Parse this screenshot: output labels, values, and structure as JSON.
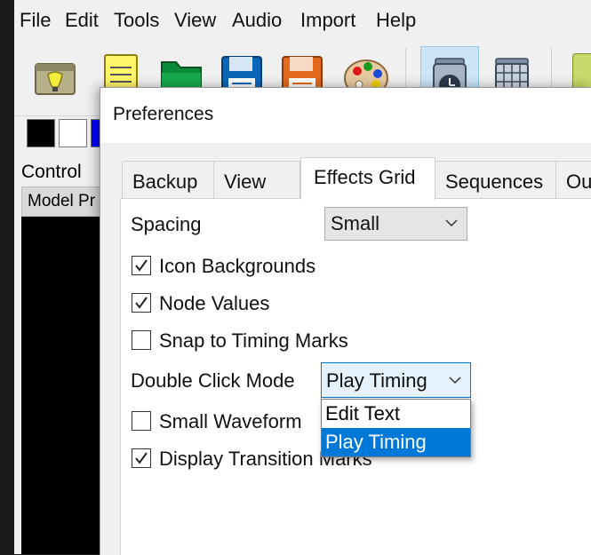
{
  "menubar": {
    "items": [
      "File",
      "Edit",
      "Tools",
      "View",
      "Audio",
      "Import",
      "Help"
    ]
  },
  "toolbar": {
    "buttons": [
      {
        "icon": "light-bulb-icon"
      },
      {
        "icon": "notepad-icon"
      },
      {
        "icon": "folder-open-icon"
      },
      {
        "icon": "save-icon"
      },
      {
        "icon": "save-as-icon"
      },
      {
        "icon": "color-palette-icon"
      },
      {
        "icon": "timer-clock-icon"
      },
      {
        "icon": "calendar-grid-icon"
      }
    ]
  },
  "colors": {
    "swatches": [
      "#000000",
      "#ffffff",
      "#0000ff"
    ],
    "selection": "#0078d7",
    "active_toolbar": "#cce4f7"
  },
  "left_panel": {
    "tab_label": "Control",
    "header_label": "Model Pr"
  },
  "dialog": {
    "title": "Preferences",
    "tabs": [
      "Backup",
      "View",
      "Effects Grid",
      "Sequences",
      "Ou"
    ],
    "active_tab": "Effects Grid",
    "spacing": {
      "label": "Spacing",
      "value": "Small"
    },
    "checkboxes": [
      {
        "label": "Icon Backgrounds",
        "checked": true
      },
      {
        "label": "Node Values",
        "checked": true
      },
      {
        "label": "Snap to Timing Marks",
        "checked": false
      },
      {
        "label": "Small Waveform",
        "checked": false
      },
      {
        "label": "Display Transition Marks",
        "checked": true
      }
    ],
    "double_click": {
      "label": "Double Click Mode",
      "value": "Play Timing",
      "options": [
        "Edit Text",
        "Play Timing"
      ],
      "selected_option": "Play Timing"
    }
  }
}
